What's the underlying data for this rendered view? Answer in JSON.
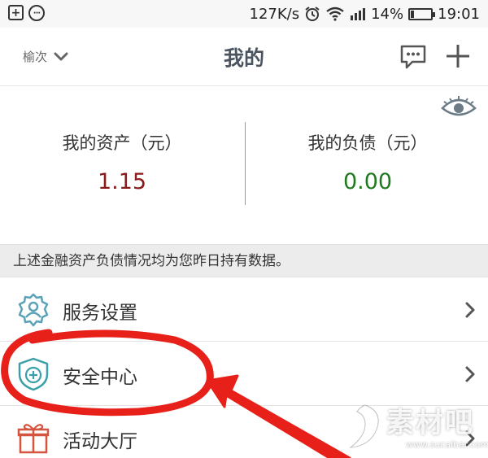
{
  "status_bar": {
    "network_speed": "127K/s",
    "battery_percent": "14%",
    "battery_level": 0.14,
    "time": "19:01",
    "icons": [
      "add-box-icon",
      "more-circle-icon",
      "alarm-icon",
      "wifi-icon",
      "signal-icon",
      "battery-icon"
    ]
  },
  "header": {
    "account_switch_label": "榆次",
    "title": "我的",
    "icons": [
      "chevron-down-icon",
      "message-icon",
      "plus-icon"
    ]
  },
  "summary": {
    "assets_label": "我的资产（元）",
    "assets_value": "1.15",
    "assets_color": "#8b1a1a",
    "liabilities_label": "我的负债（元）",
    "liabilities_value": "0.00",
    "liabilities_color": "#1f7a1f",
    "visibility_icon": "eye-icon"
  },
  "notice": {
    "text": "上述金融资产负债情况均为您昨日持有数据。"
  },
  "menu": [
    {
      "label": "服务设置",
      "icon": "gear-person-icon"
    },
    {
      "label": "安全中心",
      "icon": "shield-plus-icon"
    },
    {
      "label": "活动大厅",
      "icon": "gift-icon"
    }
  ],
  "annotation": {
    "highlight_color": "#e8201a",
    "shapes": [
      "circle-annotation",
      "arrow-annotation"
    ]
  },
  "watermark": {
    "text": "素材吧",
    "url": "www.sucaibar.com"
  }
}
